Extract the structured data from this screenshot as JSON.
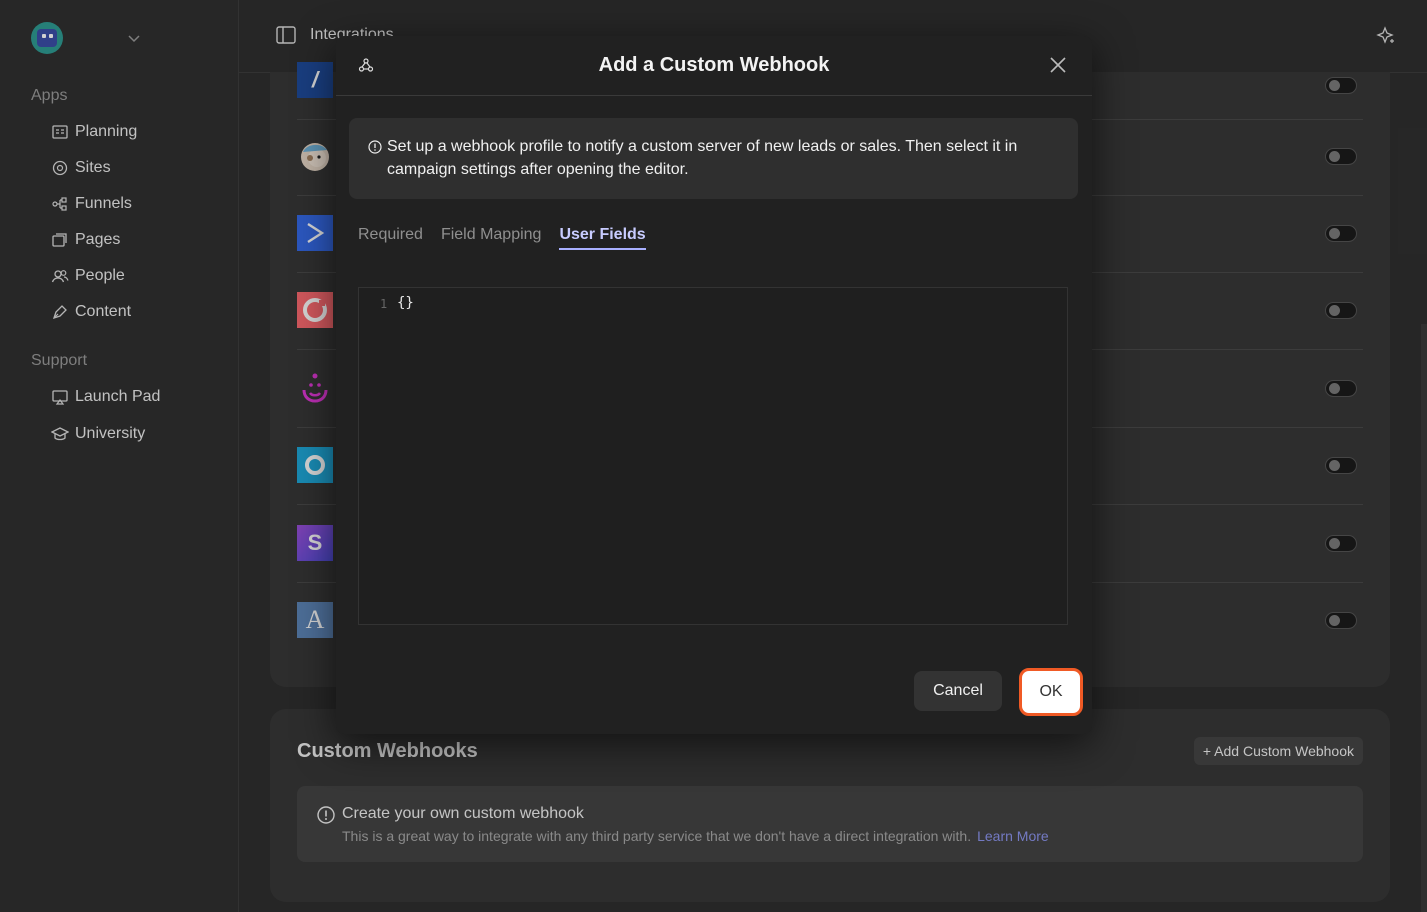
{
  "sidebar": {
    "sections": [
      {
        "label": "Apps",
        "items": [
          {
            "label": "Planning",
            "icon": "planning-icon"
          },
          {
            "label": "Sites",
            "icon": "sites-icon"
          },
          {
            "label": "Funnels",
            "icon": "funnels-icon"
          },
          {
            "label": "Pages",
            "icon": "pages-icon"
          },
          {
            "label": "People",
            "icon": "people-icon"
          },
          {
            "label": "Content",
            "icon": "content-icon"
          }
        ]
      },
      {
        "label": "Support",
        "items": [
          {
            "label": "Launch Pad",
            "icon": "launch-pad-icon"
          },
          {
            "label": "University",
            "icon": "university-icon"
          }
        ]
      }
    ]
  },
  "topbar": {
    "title": "Integrations"
  },
  "integrations": [
    {
      "logo": "zapier-like-logo",
      "letter": "",
      "bg": "#1f4b9a",
      "enabled": false
    },
    {
      "logo": "mailchimp-logo",
      "letter": "",
      "bg": "#383838",
      "enabled": false
    },
    {
      "logo": "activecampaign-logo",
      "letter": "",
      "bg": "#356ae6",
      "enabled": false
    },
    {
      "logo": "convertkit-logo",
      "letter": "",
      "bg": "#fb6970",
      "enabled": false
    },
    {
      "logo": "drip-logo",
      "letter": "",
      "bg": "#383838",
      "enabled": false
    },
    {
      "logo": "ontraport-logo",
      "letter": "",
      "bg": "#1fa8d8",
      "enabled": false
    },
    {
      "logo": "sendlane-logo",
      "letter": "S",
      "bg": "#6c4fd8",
      "enabled": false
    },
    {
      "logo": "aweber-logo",
      "letter": "A",
      "bg": "#5d86b7",
      "enabled": false
    }
  ],
  "webhooks": {
    "title": "Custom Webhooks",
    "add_button": "+ Add Custom Webhook",
    "info_heading": "Create your own custom webhook",
    "info_text": "This is a great way to integrate with any third party service that we don't have a direct integration with.",
    "learn_more": "Learn More"
  },
  "modal": {
    "title": "Add a Custom Webhook",
    "notice": "Set up a webhook profile to notify a custom server of new leads or sales. Then select it in campaign settings after opening the editor.",
    "tabs": [
      {
        "label": "Required",
        "active": false
      },
      {
        "label": "Field Mapping",
        "active": false
      },
      {
        "label": "User Fields",
        "active": true
      }
    ],
    "editor": {
      "line_number": "1",
      "code": "{}"
    },
    "cancel_label": "Cancel",
    "ok_label": "OK"
  },
  "colors": {
    "accent": "#a9b0ff",
    "ok_border": "#f05a25",
    "link": "#8d95ee"
  }
}
